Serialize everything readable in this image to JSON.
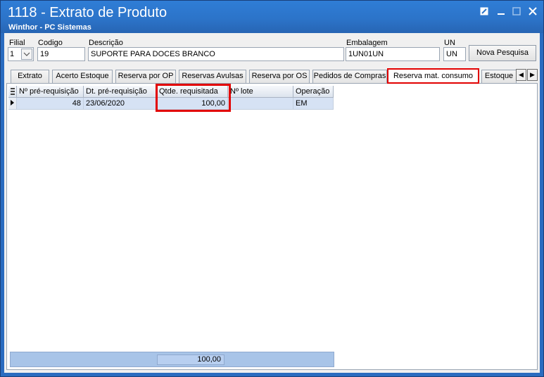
{
  "window": {
    "title": "1118 - Extrato de Produto",
    "subtitle": "Winthor - PC Sistemas"
  },
  "form": {
    "filial_label": "Filial",
    "filial_value": "1",
    "codigo_label": "Codigo",
    "codigo_value": "19",
    "descricao_label": "Descrição",
    "descricao_value": "SUPORTE PARA DOCES BRANCO",
    "embalagem_label": "Embalagem",
    "embalagem_value": "1UN01UN",
    "un_label": "UN",
    "un_value": "UN",
    "nova_pesquisa": "Nova Pesquisa"
  },
  "tabs": [
    {
      "label": "Extrato"
    },
    {
      "label": "Acerto Estoque"
    },
    {
      "label": "Reserva por OP"
    },
    {
      "label": "Reservas Avulsas"
    },
    {
      "label": "Reserva por OS"
    },
    {
      "label": "Pedidos de Compras"
    },
    {
      "label": "Reserva mat. consumo",
      "active": true
    },
    {
      "label": "Estoque"
    }
  ],
  "grid": {
    "columns": [
      "Nº pré-requisição",
      "Dt. pré-requisição",
      "Qtde. requisitada",
      "Nº lote",
      "Operação"
    ],
    "rows": [
      [
        "48",
        "23/06/2020",
        "100,00",
        "",
        "EM"
      ]
    ],
    "footer_total": "100,00"
  },
  "colors": {
    "title_bar": "#2c74c9",
    "highlight": "#e20000",
    "selected_row": "#d6e2f4"
  }
}
